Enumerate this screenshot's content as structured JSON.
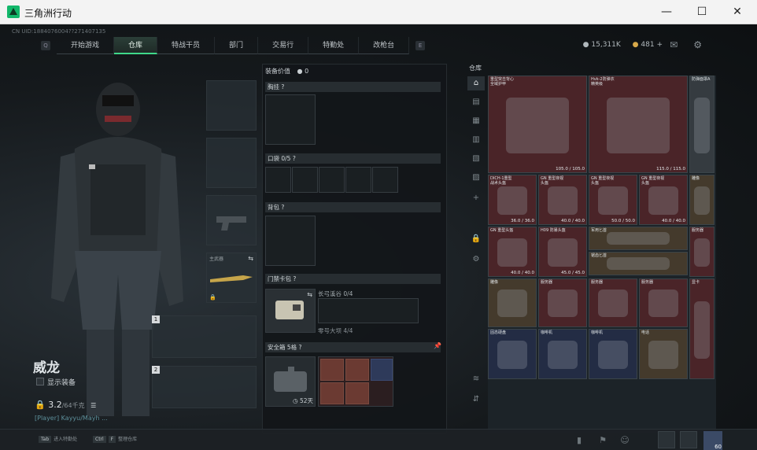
{
  "window": {
    "title": "三角洲行动",
    "minimize": "—",
    "maximize": "☐",
    "close": "✕"
  },
  "uid": "CN UID:1884076004??271407135",
  "nav": {
    "key_left": "Q",
    "key_right": "E",
    "tabs": [
      "开始游戏",
      "仓库",
      "特战干员",
      "部门",
      "交易行",
      "特勤处",
      "改枪台"
    ],
    "active_tab": "仓库"
  },
  "currency": {
    "coins": "15,311K",
    "tickets": "481",
    "add": "+"
  },
  "operator": {
    "name": "威龙",
    "show_gear": "显示装备",
    "weight": "3.2",
    "weight_unit": "/64千克",
    "user_line": "[Player] Kayyu/Mayh   ..."
  },
  "equipment": {
    "weapon_label": "主武器",
    "slot1": "1",
    "slot2": "2"
  },
  "middle": {
    "gear_value_label": "装备价值",
    "gear_value": "0",
    "chest": "胸挂 ?",
    "pockets": "口袋 0/5 ?",
    "backpack": "背包 ?",
    "keycard": "门禁卡包 ?",
    "long_window": "长弓溪谷 0/4",
    "zero_dam": "零号大坝 4/4",
    "safe_box": "安全箱 5格 ?",
    "safe_time": "52天"
  },
  "warehouse": {
    "label": "仓库",
    "items": [
      {
        "name": "重型突击背心\n全域护甲",
        "dur": "105.0 / 105.0",
        "color": "red"
      },
      {
        "name": "Hvk-2防弹衣\n精英级",
        "dur": "115.0 / 115.0",
        "color": "red"
      },
      {
        "name": "防弹面罩A",
        "dur": "",
        "color": "grey"
      },
      {
        "name": "DICH-1重型\n战术头盔",
        "dur": "36.0 / 36.0",
        "color": "red"
      },
      {
        "name": "GN 重型夜视\n头盔",
        "dur": "40.0 / 40.0",
        "color": "red"
      },
      {
        "name": "GN 重型夜视\n头盔",
        "dur": "50.0 / 50.0",
        "color": "red"
      },
      {
        "name": "GN 重型夜视\n头盔",
        "dur": "40.0 / 40.0",
        "color": "red"
      },
      {
        "name": "GN 重型头盔",
        "dur": "40.0 / 40.0",
        "color": "red"
      },
      {
        "name": "H09 防暴头盔",
        "dur": "45.0 / 45.0",
        "color": "red"
      },
      {
        "name": "军用匕首",
        "dur": "",
        "color": "gold"
      },
      {
        "name": "锯齿匕首",
        "dur": "",
        "color": "gold"
      },
      {
        "name": "雕像",
        "dur": "",
        "color": "gold"
      },
      {
        "name": "雕像",
        "dur": "",
        "color": "gold"
      },
      {
        "name": "服务器",
        "dur": "",
        "color": "red"
      },
      {
        "name": "服务器",
        "dur": "",
        "color": "red"
      },
      {
        "name": "服务器",
        "dur": "",
        "color": "red"
      },
      {
        "name": "服务器",
        "dur": "",
        "color": "red"
      },
      {
        "name": "固态硬盘",
        "dur": "",
        "color": "blue"
      },
      {
        "name": "咖啡机",
        "dur": "",
        "color": "blue"
      },
      {
        "name": "咖啡机",
        "dur": "",
        "color": "blue"
      },
      {
        "name": "电话",
        "dur": "",
        "color": "gold"
      },
      {
        "name": "显卡",
        "dur": "",
        "color": "red"
      }
    ]
  },
  "bottom": {
    "key1": "Tab",
    "key1_label": "进入特勤处",
    "key2": "Ctrl",
    "key2b": "F",
    "key2_label": "整理仓库",
    "avatar_level": "60"
  },
  "colors": {
    "accent": "#3fd98a",
    "red_item": "#4a2428",
    "blue_item": "#232c44",
    "gold_item": "#443a2c"
  }
}
